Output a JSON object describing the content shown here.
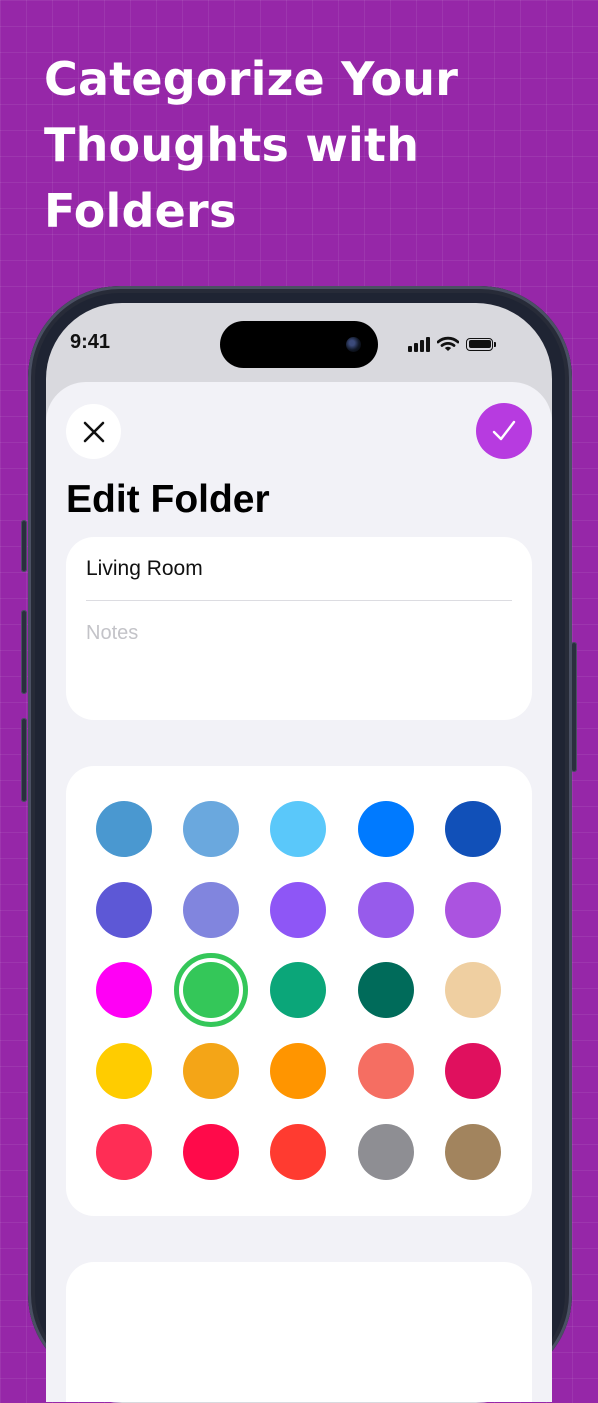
{
  "headline": {
    "line1": "Categorize Your",
    "line2": "Thoughts with",
    "line3": "Folders"
  },
  "status_bar": {
    "time": "9:41"
  },
  "sheet": {
    "title": "Edit Folder",
    "folder_name": "Living Room",
    "notes_placeholder": "Notes"
  },
  "colors": {
    "accent": "#b73be0",
    "background": "#9627a8",
    "selected_index": 11,
    "swatches": [
      "#4a98d0",
      "#6aa8de",
      "#5ac8fa",
      "#007aff",
      "#1150b8",
      "#5d58d6",
      "#8185de",
      "#8e56f6",
      "#975beb",
      "#ab53e0",
      "#ff00f5",
      "#34c759",
      "#0ba679",
      "#006b5a",
      "#efcfa1",
      "#ffcc00",
      "#f4a517",
      "#ff9500",
      "#f56e62",
      "#e0105e",
      "#ff2d55",
      "#ff0a4a",
      "#ff3b30",
      "#8e8e93",
      "#a2845e"
    ]
  }
}
